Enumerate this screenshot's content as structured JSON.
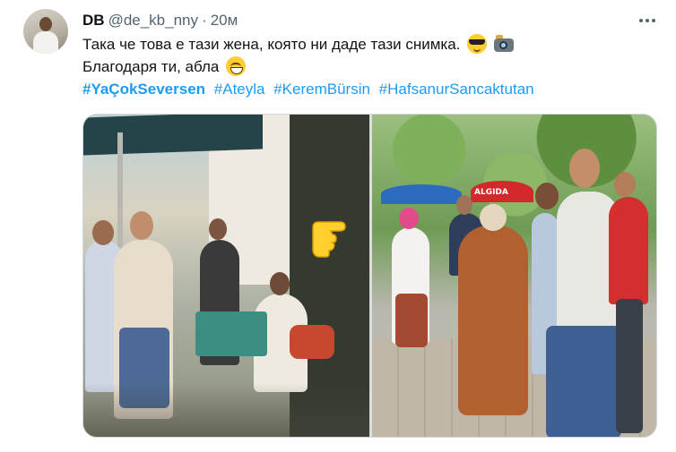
{
  "tweet": {
    "author": {
      "name": "DB",
      "handle": "@de_kb_nny",
      "separator": "·",
      "time": "20м"
    },
    "text": {
      "line1": "Така че това е тази жена, която ни даде тази снимка.",
      "line2": "Благодаря ти, абла"
    },
    "hashtags": [
      "#YaÇokSeversen",
      "#Ateyla",
      "#KeremBürsin",
      "#HafsanurSancaktutan"
    ],
    "emojis": [
      "smiling-face-with-sunglasses",
      "camera-with-flash",
      "grinning-face-with-smiling-eyes"
    ],
    "media": {
      "photo_count": 2,
      "storefront_sign": "ALGIDA"
    },
    "colors": {
      "link": "#1d9bf0",
      "secondary_text": "#536471",
      "primary_text": "#0f1419",
      "border": "#cfd9de"
    }
  }
}
